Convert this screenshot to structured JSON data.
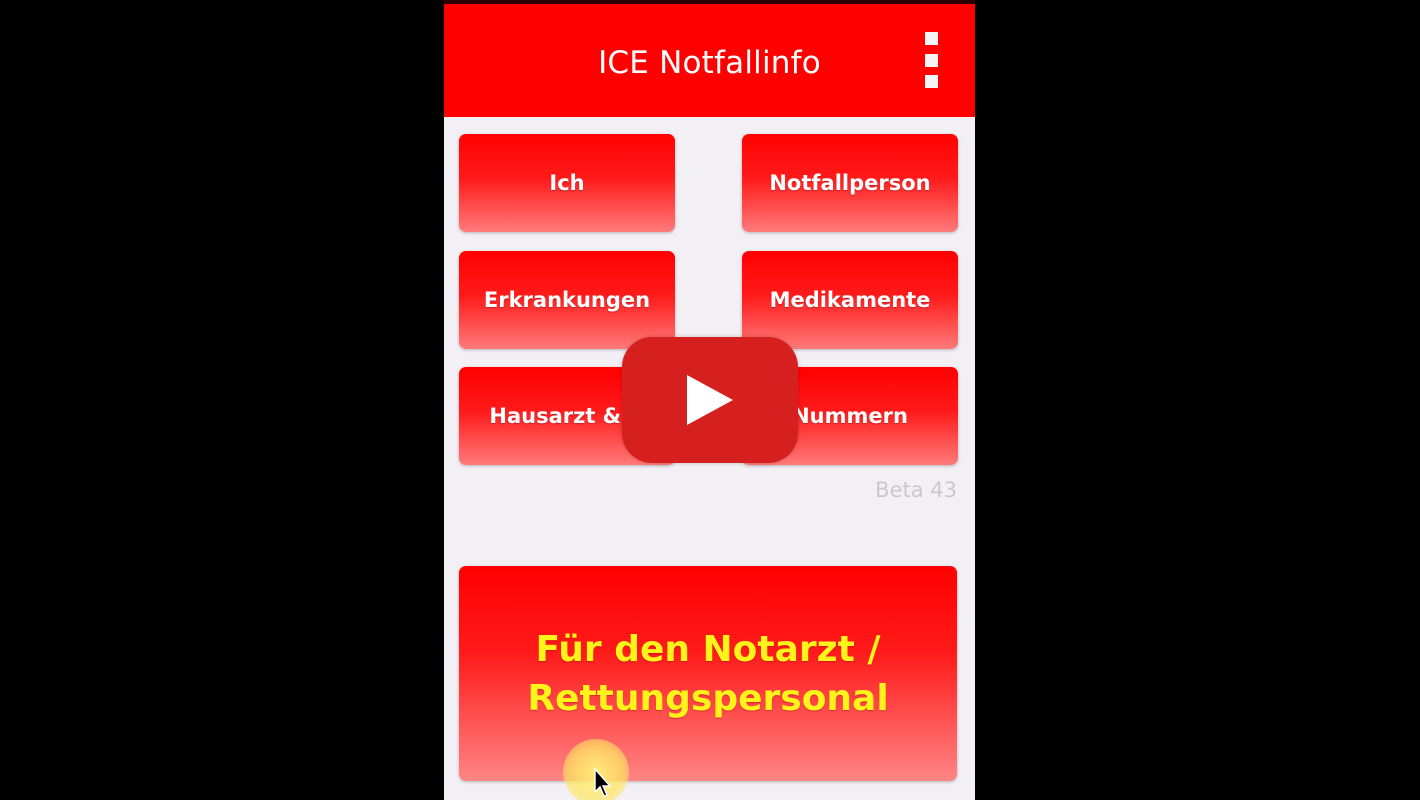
{
  "app": {
    "title": "ICE Notfallinfo",
    "menu_icon": "overflow-menu-icon"
  },
  "tiles": [
    {
      "label": "Ich"
    },
    {
      "label": "Notfallperson"
    },
    {
      "label": "Erkrankungen"
    },
    {
      "label": "Medikamente"
    },
    {
      "label": "Hausarzt & K"
    },
    {
      "label": "Nummern"
    }
  ],
  "version": "Beta 43",
  "emergency": {
    "line1": "Für den Notarzt /",
    "line2": "Rettungspersonal"
  },
  "video": {
    "play_icon": "play-icon",
    "cursor_icon": "mouse-pointer-icon"
  },
  "colors": {
    "primary_red": "#fe0000",
    "emergency_text": "#fff31a",
    "play_button": "#d62020"
  }
}
